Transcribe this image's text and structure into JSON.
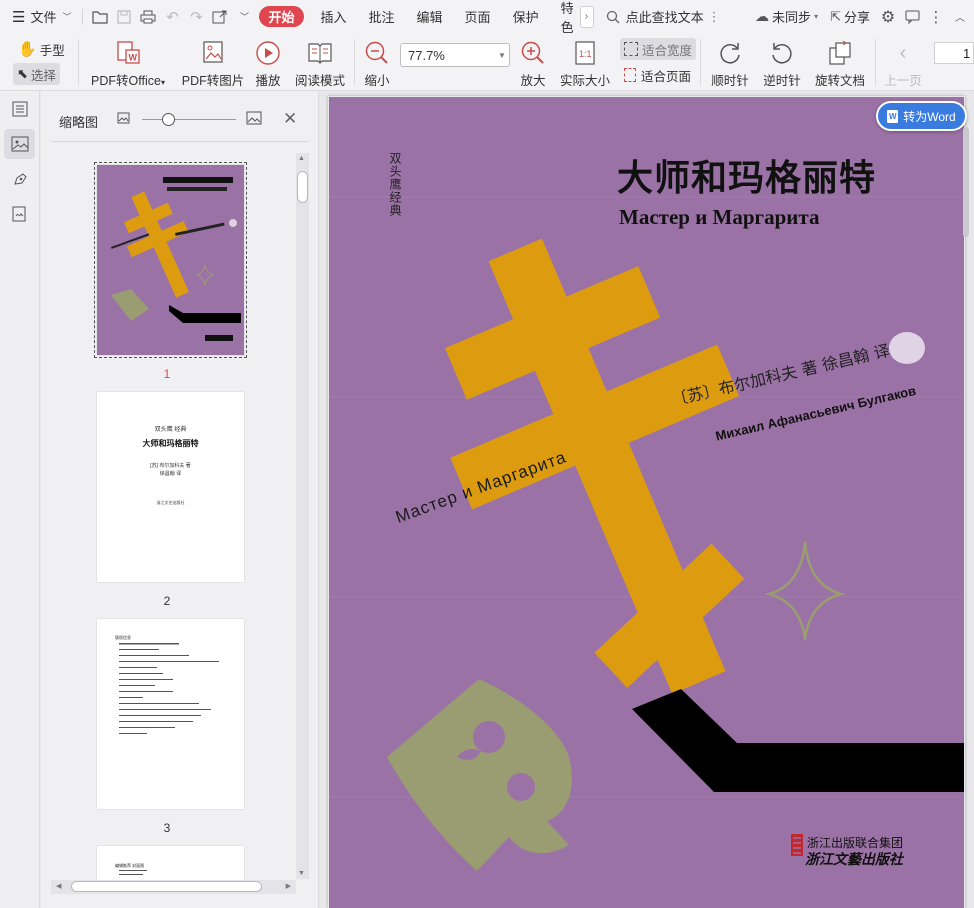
{
  "menubar": {
    "file_label": "文件",
    "tabs": [
      "开始",
      "插入",
      "批注",
      "编辑",
      "页面",
      "保护",
      "特色"
    ],
    "search_label": "点此查找文本",
    "sync_label": "未同步",
    "share_label": "分享"
  },
  "ribbon": {
    "hand_label": "手型",
    "select_label": "选择",
    "pdf_to_office": "PDF转Office",
    "pdf_to_image": "PDF转图片",
    "play": "播放",
    "read_mode": "阅读模式",
    "zoom_out": "缩小",
    "zoom_value": "77.7%",
    "zoom_in": "放大",
    "actual_size": "实际大小",
    "fit_width": "适合宽度",
    "fit_page": "适合页面",
    "clockwise": "顺时针",
    "counterclockwise": "逆时针",
    "rotate_doc": "旋转文档",
    "prev_page": "上一页",
    "page_number": "1"
  },
  "thumbs": {
    "title": "缩略图",
    "pages": [
      "1",
      "2",
      "3"
    ],
    "page2": {
      "series": "双头鹰 经典",
      "title": "大师和玛格丽特",
      "author": "[苏] 布尔加科夫 著",
      "translator": "徐昌翰 译",
      "publisher": "浙江文艺出版社"
    },
    "page3_heading": "版权信息",
    "page4_heading": "编辑推荐 封面图"
  },
  "cover": {
    "series": "双头鹰经典",
    "title_cn": "大师和玛格丽特",
    "title_ru": "Мастер и Маргарита",
    "author_cn": "〔苏〕布尔加科夫 著   徐昌翰 译",
    "author_ru": "Михаил Афанасьевич Булгаков",
    "diag_ru": "Мастер и Маргарита",
    "publisher_group": "浙江出版联合集团",
    "publisher": "浙江文藝出版社",
    "convert_button": "转为Word"
  },
  "colors": {
    "accent": "#e0464f",
    "cover_bg": "#9b72a6",
    "cross": "#dd9c10",
    "olive": "#9a9c72",
    "word_button": "#3a7be0"
  }
}
